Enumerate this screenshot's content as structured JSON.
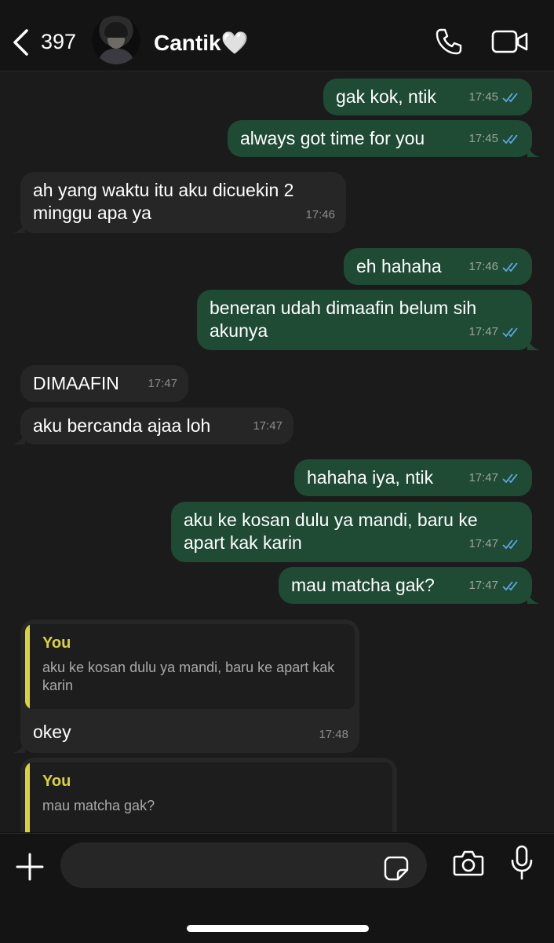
{
  "header": {
    "back_count": "397",
    "contact_name": "Cantik🤍"
  },
  "messages": [
    {
      "direction": "out",
      "text": "gak kok, ntik",
      "time": "17:45"
    },
    {
      "direction": "out",
      "text": "always got time for you",
      "time": "17:45"
    },
    {
      "direction": "in",
      "text": "ah yang waktu itu aku dicuekin 2\nminggu apa ya",
      "time": "17:46"
    },
    {
      "direction": "out",
      "text": "eh hahaha",
      "time": "17:46"
    },
    {
      "direction": "out",
      "text": "beneran udah dimaafin belum sih\nakunya",
      "time": "17:47"
    },
    {
      "direction": "in",
      "text": "DIMAAFIN",
      "time": "17:47"
    },
    {
      "direction": "in",
      "text": "aku bercanda ajaa loh",
      "time": "17:47"
    },
    {
      "direction": "out",
      "text": "hahaha iya, ntik",
      "time": "17:47"
    },
    {
      "direction": "out",
      "text": "aku ke kosan dulu ya mandi, baru ke\napart kak karin",
      "time": "17:47"
    },
    {
      "direction": "out",
      "text": "mau matcha gak?",
      "time": "17:47"
    },
    {
      "direction": "in",
      "quote_author": "You",
      "quote_text": "aku ke kosan dulu ya mandi, baru ke apart kak karin",
      "text": "okey",
      "time": "17:48"
    },
    {
      "direction": "in",
      "quote_author": "You",
      "quote_text": "mau matcha gak?"
    }
  ],
  "composer": {
    "placeholder": ""
  },
  "colors": {
    "outgoing_bubble": "#1f4a34",
    "incoming_bubble": "#262626",
    "read_ticks": "#5aa9e6",
    "quote_accent": "#d9d23a"
  },
  "icons": [
    "back-chevron-icon",
    "phone-call-icon",
    "video-camera-icon",
    "plus-icon",
    "sticker-icon",
    "camera-icon",
    "microphone-icon",
    "double-check-read-icon"
  ]
}
